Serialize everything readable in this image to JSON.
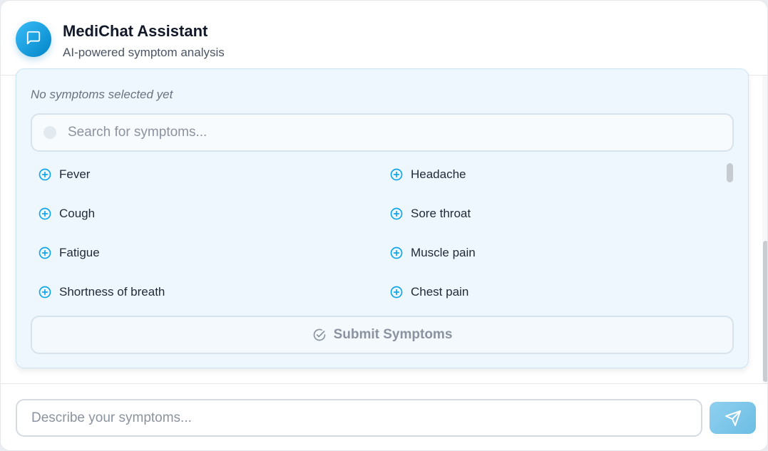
{
  "header": {
    "title": "MediChat Assistant",
    "subtitle": "AI-powered symptom analysis",
    "avatar_icon": "chat-bubble-icon"
  },
  "symptom_picker": {
    "empty_state": "No symptoms selected yet",
    "search_placeholder": "Search for symptoms...",
    "symptoms": [
      {
        "label": "Fever"
      },
      {
        "label": "Headache"
      },
      {
        "label": "Cough"
      },
      {
        "label": "Sore throat"
      },
      {
        "label": "Fatigue"
      },
      {
        "label": "Muscle pain"
      },
      {
        "label": "Shortness of breath"
      },
      {
        "label": "Chest pain"
      }
    ],
    "submit_label": "Submit Symptoms"
  },
  "composer": {
    "placeholder": "Describe your symptoms...",
    "send_icon": "send-icon"
  },
  "colors": {
    "accent": "#0ea5e9",
    "panel_bg": "#eef7fd",
    "send_button": "#7cc6e9"
  }
}
